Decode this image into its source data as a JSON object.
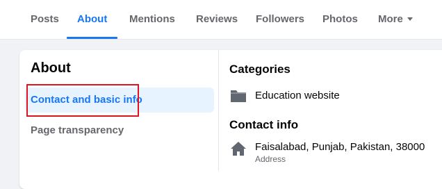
{
  "tabs": [
    {
      "label": "Posts",
      "active": false
    },
    {
      "label": "About",
      "active": true
    },
    {
      "label": "Mentions",
      "active": false
    },
    {
      "label": "Reviews",
      "active": false
    },
    {
      "label": "Followers",
      "active": false
    },
    {
      "label": "Photos",
      "active": false
    },
    {
      "label": "More",
      "active": false,
      "icon": "caret-down-icon"
    }
  ],
  "colors": {
    "accent": "#1877f2",
    "highlight_border": "#e0141e",
    "active_nav_bg": "#e7f3ff",
    "secondary_text": "#65676b"
  },
  "sidebar": {
    "heading": "About",
    "items": [
      {
        "label": "Contact and basic info",
        "active": true
      },
      {
        "label": "Page transparency",
        "active": false
      }
    ]
  },
  "main": {
    "categories": {
      "title": "Categories",
      "items": [
        {
          "icon": "folder-icon",
          "text": "Education website"
        }
      ]
    },
    "contact_info": {
      "title": "Contact info",
      "items": [
        {
          "icon": "home-icon",
          "text": "Faisalabad, Punjab, Pakistan, 38000",
          "sub": "Address"
        }
      ]
    }
  }
}
